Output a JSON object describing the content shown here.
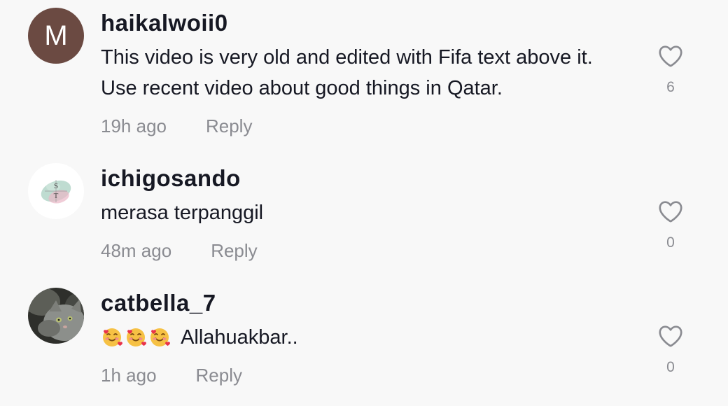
{
  "comments": [
    {
      "avatar_letter": "M",
      "username": "haikalwoii0",
      "text": "This video is very old and edited with Fifa text above it. Use recent video about good things in Qatar.",
      "time": "19h ago",
      "reply_label": "Reply",
      "likes": "6"
    },
    {
      "avatar_text_1": "S",
      "avatar_text_2": "T",
      "username": "ichigosando",
      "text": "merasa terpanggil",
      "time": "48m ago",
      "reply_label": "Reply",
      "likes": "0"
    },
    {
      "username": "catbella_7",
      "text": "Allahuakbar..",
      "emojis": "🥰🥰🥰",
      "time": "1h ago",
      "reply_label": "Reply",
      "likes": "0"
    }
  ],
  "icons": {
    "like": "heart-outline-icon",
    "emoji": "smiling-face-with-hearts"
  },
  "colors": {
    "background": "#f8f8f8",
    "username": "#161823",
    "meta": "#8a8b91",
    "avatar_m": "#6b4a42"
  }
}
